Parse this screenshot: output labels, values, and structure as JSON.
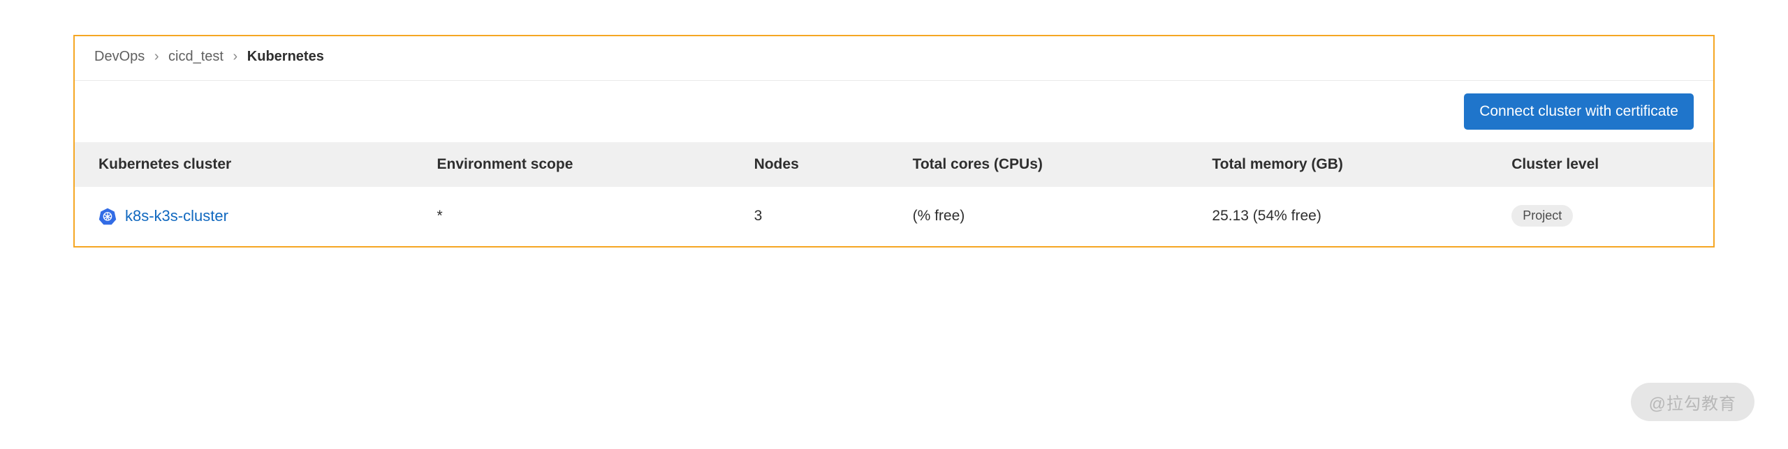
{
  "breadcrumb": {
    "items": [
      "DevOps",
      "cicd_test"
    ],
    "current": "Kubernetes"
  },
  "toolbar": {
    "connect_label": "Connect cluster with certificate"
  },
  "table": {
    "headers": {
      "cluster": "Kubernetes cluster",
      "env_scope": "Environment scope",
      "nodes": "Nodes",
      "cores": "Total cores (CPUs)",
      "memory": "Total memory (GB)",
      "level": "Cluster level"
    },
    "row": {
      "name": "k8s-k3s-cluster",
      "env_scope": "*",
      "nodes": "3",
      "cores": "(% free)",
      "memory": "25.13 (54% free)",
      "level": "Project"
    }
  },
  "watermark": "@拉勾教育"
}
